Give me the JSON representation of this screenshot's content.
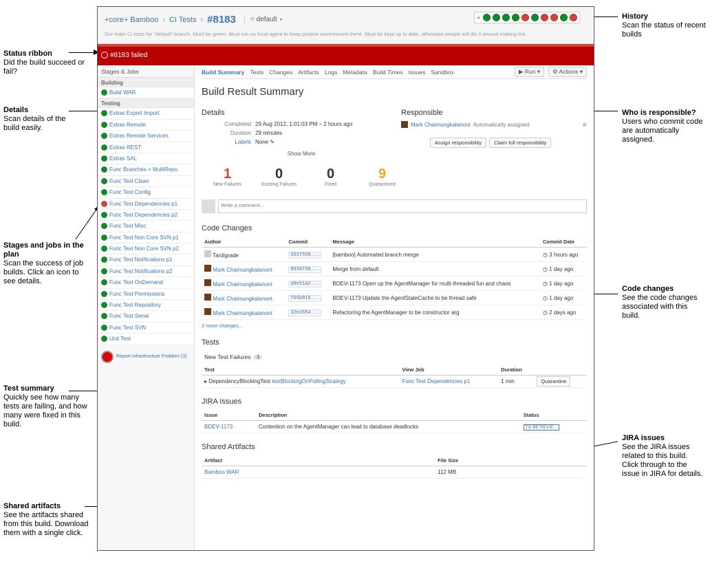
{
  "annotations": {
    "history": {
      "title": "History",
      "text": "Scan the status of recent builds"
    },
    "status_ribbon": {
      "title": "Status ribbon",
      "text": "Did the build succeed or fail?"
    },
    "details": {
      "title": "Details",
      "text": "Scan details of the build easily."
    },
    "responsible": {
      "title": "Who is responsible?",
      "text": "Users who commit code are automatically assigned."
    },
    "stages": {
      "title": "Stages and jobs in the plan",
      "text": "Scan the success of job builds. Click an icon to see details."
    },
    "code_changes": {
      "title": "Code changes",
      "text": "See the code changes associated with this build."
    },
    "test_summary": {
      "title": "Test summary",
      "text": "Quickly see how many tests are failing, and how many were fixed in this build."
    },
    "jira": {
      "title": "JIRA issues",
      "text": "See the JIRA issues related to this build. Click through to the issue in JIRA for details."
    },
    "artifacts": {
      "title": "Shared artifacts",
      "text": "See the artifacts shared from this build. Download them with a single click."
    }
  },
  "header": {
    "project": "+core+ Bamboo",
    "plan": "CI Tests",
    "build_number": "#8183",
    "branch": "default",
    "description": "Our main CI tests for \"default\" branch. Must be green. Must run on local agent to keep pristine environment there. Must be kept up to date, otherwise people will dis it around making the...",
    "history": [
      "ok",
      "ok",
      "ok",
      "ok",
      "fail",
      "ok",
      "fail",
      "fail",
      "ok",
      "fail"
    ]
  },
  "ribbon": {
    "text": "#8183 failed"
  },
  "sidebar": {
    "heading": "Stages & Jobs",
    "stages": [
      {
        "name": "Building",
        "jobs": [
          {
            "label": "Build WAR",
            "status": "ok"
          }
        ]
      },
      {
        "name": "Testing",
        "jobs": [
          {
            "label": "Extras Export Import",
            "status": "ok"
          },
          {
            "label": "Extras Remote",
            "status": "ok"
          },
          {
            "label": "Extras Remote Services",
            "status": "ok"
          },
          {
            "label": "Extras REST",
            "status": "ok"
          },
          {
            "label": "Extras SAL",
            "status": "ok"
          },
          {
            "label": "Func Branches + MultiRepo",
            "status": "ok"
          },
          {
            "label": "Func Test Clean",
            "status": "ok"
          },
          {
            "label": "Func Test Config",
            "status": "ok"
          },
          {
            "label": "Func Test Dependencies p1",
            "status": "fail"
          },
          {
            "label": "Func Test Dependencies p2",
            "status": "ok"
          },
          {
            "label": "Func Test Misc",
            "status": "ok"
          },
          {
            "label": "Func Test Non Core SVN p1",
            "status": "ok"
          },
          {
            "label": "Func Test Non Core SVN p2",
            "status": "ok"
          },
          {
            "label": "Func Test Notifications p1",
            "status": "ok"
          },
          {
            "label": "Func Test Notifications p2",
            "status": "ok"
          },
          {
            "label": "Func Test OnDemand",
            "status": "ok"
          },
          {
            "label": "Func Test Permissions",
            "status": "ok"
          },
          {
            "label": "Func Test Repository",
            "status": "ok"
          },
          {
            "label": "Func Test Serial",
            "status": "ok"
          },
          {
            "label": "Func Test SVN",
            "status": "ok"
          },
          {
            "label": "Unit Test",
            "status": "ok"
          }
        ]
      }
    ],
    "panic": "Report infrastructure Problem (3)"
  },
  "tabs": [
    "Build Summary",
    "Tests",
    "Changes",
    "Artifacts",
    "Logs",
    "Metadata",
    "Build Times",
    "Issues",
    "Sandbox"
  ],
  "tab_actions": {
    "run": "Run",
    "actions": "Actions"
  },
  "summary": {
    "title": "Build Result Summary",
    "details_heading": "Details",
    "completed_label": "Completed",
    "completed_value": "29 Aug 2012, 1:01:03 PM – 2 hours ago",
    "duration_label": "Duration",
    "duration_value": "29 minutes",
    "labels_label": "Labels",
    "labels_value": "None",
    "show_more": "Show More",
    "responsible_heading": "Responsible",
    "responsible_user": "Mark Chaimungkalanont",
    "responsible_note": "Automatically assigned",
    "assign_btn": "Assign responsibility",
    "claim_btn": "Claim full responsibility",
    "stats": [
      {
        "n": "1",
        "l": "New Failures",
        "color": "#d04437"
      },
      {
        "n": "0",
        "l": "Existing Failures",
        "color": "#333333"
      },
      {
        "n": "0",
        "l": "Fixed",
        "color": "#333333"
      },
      {
        "n": "9",
        "l": "Quarantined",
        "color": "#f6a31b"
      }
    ],
    "comment_placeholder": "Write a comment..."
  },
  "code_changes": {
    "heading": "Code Changes",
    "cols": [
      "Author",
      "Commit",
      "Message",
      "Commit Date"
    ],
    "rows": [
      {
        "author": "Tardigrade",
        "commit": "5537558...",
        "message": "[bamboo] Automated branch merge",
        "date": "3 hours ago"
      },
      {
        "author": "Mark Chaimungkalanont",
        "commit": "9534f08...",
        "message": "Merge from default",
        "date": "1 day ago"
      },
      {
        "author": "Mark Chaimungkalanont",
        "commit": "d8e51a2...",
        "message": "BDEV-1173 Open up the AgentManager for multi-threaded fun and chaos",
        "date": "1 day ago"
      },
      {
        "author": "Mark Chaimungkalanont",
        "commit": "f65b810...",
        "message": "BDEV-1173 Update the AgentStateCache to be thread safe",
        "date": "1 day ago"
      },
      {
        "author": "Mark Chaimungkalanont",
        "commit": "32e2654...",
        "message": "Refactoring the AgentManager to be constructor arg",
        "date": "2 days ago"
      }
    ],
    "more": "2 more changes..."
  },
  "tests": {
    "heading": "Tests",
    "new_failures": "New Test Failures",
    "count": "1",
    "cols": [
      "Test",
      "View Job",
      "Duration"
    ],
    "rows": [
      {
        "test": "DependencyBlockingTest",
        "method": "testBlockingOnPollingStrategy",
        "job": "Func Test Dependencies p1",
        "duration": "1 min",
        "action": "Quarantine"
      }
    ]
  },
  "jira": {
    "heading": "JIRA Issues",
    "cols": [
      "Issue",
      "Description",
      "Status"
    ],
    "rows": [
      {
        "issue": "BDEV-1173",
        "desc": "Contention on the AgentManager can lead to database deadlocks",
        "status": "TO BE REVIE..."
      }
    ]
  },
  "artifacts": {
    "heading": "Shared Artifacts",
    "cols": [
      "Artifact",
      "File Size"
    ],
    "rows": [
      {
        "name": "Bamboo WAR",
        "size": "112 MB"
      }
    ]
  }
}
